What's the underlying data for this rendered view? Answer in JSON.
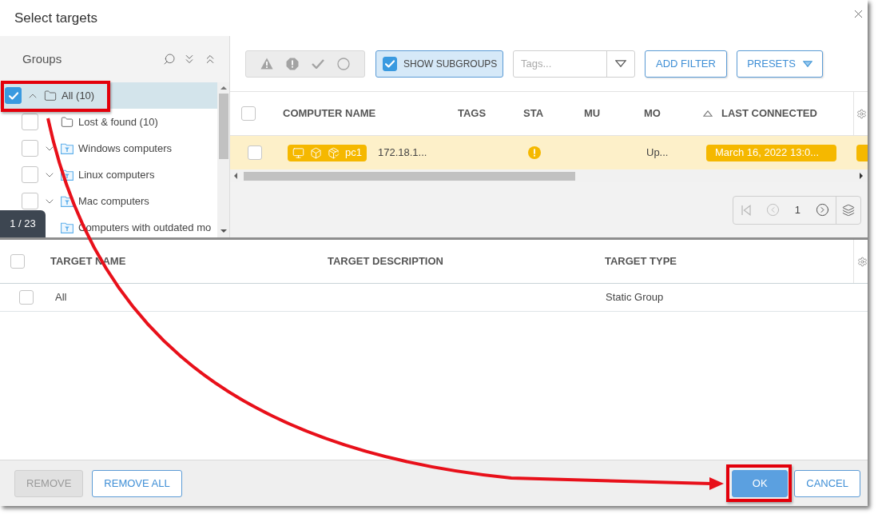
{
  "dialog": {
    "title": "Select targets"
  },
  "groups_panel": {
    "title": "Groups",
    "tree": [
      {
        "label": "All (10)",
        "kind": "static",
        "checked": true,
        "selected": true,
        "expanded": true,
        "children": [
          {
            "label": "Lost & found (10)",
            "kind": "static",
            "checked": false,
            "selected": false
          },
          {
            "label": "Windows computers",
            "kind": "dynamic",
            "checked": false,
            "selected": false,
            "expanded": false
          },
          {
            "label": "Linux computers",
            "kind": "dynamic",
            "checked": false,
            "selected": false,
            "expanded": false
          },
          {
            "label": "Mac computers",
            "kind": "dynamic",
            "checked": false,
            "selected": false,
            "expanded": false
          },
          {
            "label": "Computers with outdated mo",
            "kind": "dynamic",
            "selected": false
          }
        ]
      }
    ],
    "page_indicator": "1 / 23"
  },
  "toolbar": {
    "status_filters": [
      {
        "kind": "warning",
        "selected": false
      },
      {
        "kind": "critical",
        "selected": false
      },
      {
        "kind": "ok",
        "selected": false
      },
      {
        "kind": "unknown",
        "selected": false
      }
    ],
    "show_subgroups": {
      "label": "SHOW SUBGROUPS",
      "checked": true
    },
    "tags": {
      "placeholder": "Tags..."
    },
    "add_filter": "ADD FILTER",
    "presets": "PRESETS"
  },
  "computers_table": {
    "all_checked": false,
    "columns": [
      {
        "label": "COMPUTER NAME",
        "sorted": false
      },
      {
        "label": "TAGS",
        "sorted": false
      },
      {
        "label": "STA",
        "sorted": false
      },
      {
        "label": "MU",
        "sorted": false
      },
      {
        "label": "MO",
        "sorted": false
      },
      {
        "label": "LAST CONNECTED",
        "sorted": true
      }
    ],
    "rows": [
      {
        "checked": false,
        "kind": "warning",
        "computer_name": "pc1",
        "ip": "172.18.1...",
        "mo": "Up...",
        "last_connected": "March 16, 2022 13:0..."
      }
    ],
    "pagination": {
      "page": "1",
      "buttons": [
        {
          "kind": "first",
          "disabled": true
        },
        {
          "kind": "previous",
          "disabled": true
        },
        {
          "kind": "next",
          "disabled": false
        }
      ]
    }
  },
  "targets_table": {
    "all_checked": false,
    "columns": [
      "TARGET NAME",
      "TARGET DESCRIPTION",
      "TARGET TYPE"
    ],
    "rows": [
      {
        "checked": false,
        "name": "All",
        "type": "Static Group"
      }
    ]
  },
  "footer": {
    "left_buttons": [
      {
        "label": "REMOVE",
        "kind": "secondary",
        "disabled": true
      },
      {
        "label": "REMOVE ALL",
        "kind": "secondary",
        "disabled": false
      }
    ],
    "right_buttons": [
      {
        "label": "OK",
        "kind": "primary",
        "disabled": false
      },
      {
        "label": "CANCEL",
        "kind": "secondary",
        "disabled": false
      }
    ]
  }
}
